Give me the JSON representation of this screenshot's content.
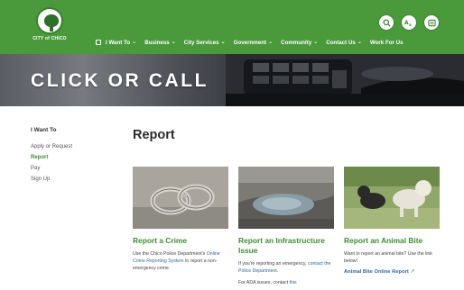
{
  "header": {
    "logo_text": "CITY of CHICO",
    "nav": [
      {
        "label": "I Want To",
        "has_menu": true,
        "icon": "square-icon"
      },
      {
        "label": "Business",
        "has_menu": true
      },
      {
        "label": "City Services",
        "has_menu": true
      },
      {
        "label": "Government",
        "has_menu": true
      },
      {
        "label": "Community",
        "has_menu": true
      },
      {
        "label": "Contact Us",
        "has_menu": true
      },
      {
        "label": "Work For Us",
        "has_menu": false
      }
    ],
    "buttons": [
      "search-icon",
      "translate-icon",
      "grid-icon"
    ],
    "brand_color": "#4a9a3c"
  },
  "hero": {
    "title": "CLICK OR CALL"
  },
  "sidebar": {
    "heading": "I Want To",
    "items": [
      {
        "label": "Apply or Request",
        "active": false
      },
      {
        "label": "Report",
        "active": true
      },
      {
        "label": "Pay",
        "active": false
      },
      {
        "label": "Sign Up",
        "active": false
      }
    ]
  },
  "main": {
    "title": "Report",
    "cards": [
      {
        "title": "Report a Crime",
        "text_before": "Use the Chico Police Department's ",
        "text_link": "Online Crime Reporting System",
        "text_after": " to report a non-emergency crime.",
        "image": "handcuffs"
      },
      {
        "title": "Report an Infrastructure Issue",
        "text_before": "If you're reporting an emergency, ",
        "text_link": "contact the Police Department",
        "text_after": ".",
        "text2_before": "For ADA issues, contact ",
        "text2_link": "this",
        "image": "pothole"
      },
      {
        "title": "Report an Animal Bite",
        "text_before": "Want to report an animal bite? Use the link below!",
        "text_link": "",
        "text_after": "",
        "link": "Animal Bite Online Report",
        "image": "dogs"
      }
    ]
  },
  "colors": {
    "accent": "#3f8c34",
    "link": "#2f6aa8"
  }
}
